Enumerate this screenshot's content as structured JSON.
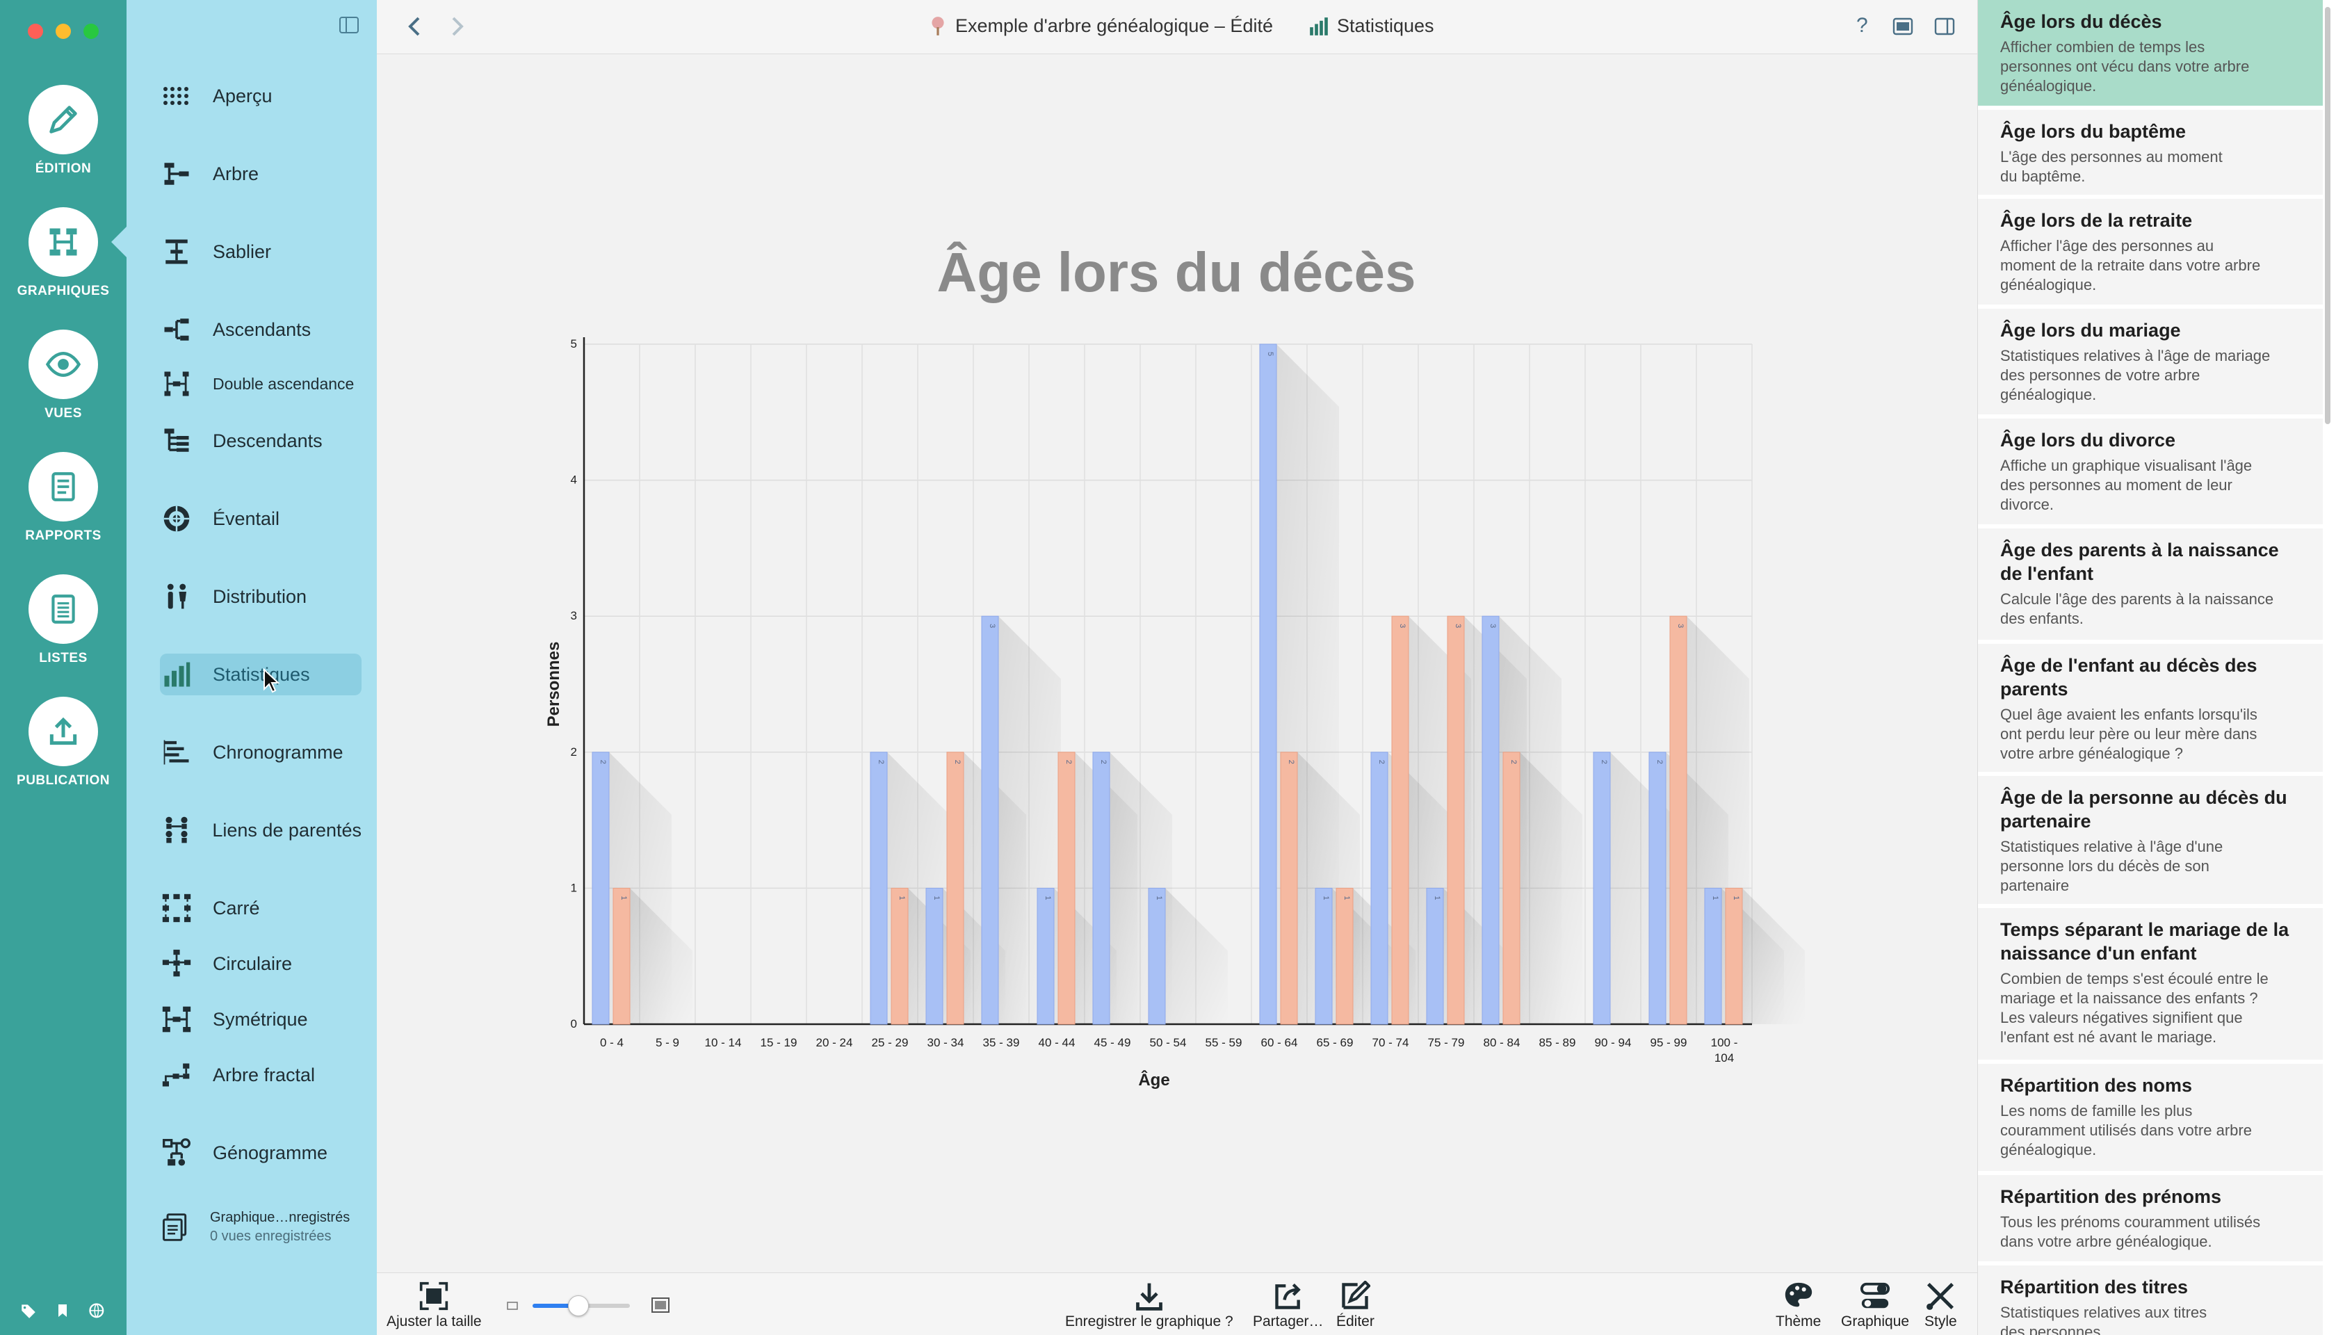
{
  "colors": {
    "rail_bg": "#3aa29a",
    "sidebar_bg": "#a8e0ef",
    "male_bar": "#a8c0f5",
    "female_bar": "#f5b9a1",
    "active_right": "#a9dcc9"
  },
  "modes": [
    {
      "label": "ÉDITION",
      "icon": "pencil-icon"
    },
    {
      "label": "GRAPHIQUES",
      "icon": "tree-chart-icon"
    },
    {
      "label": "VUES",
      "icon": "eye-icon"
    },
    {
      "label": "RAPPORTS",
      "icon": "report-icon"
    },
    {
      "label": "LISTES",
      "icon": "list-icon"
    },
    {
      "label": "PUBLICATION",
      "icon": "upload-icon"
    }
  ],
  "sidebar": {
    "items": [
      {
        "label": "Aperçu",
        "icon": "dots-grid-icon"
      },
      {
        "label": "Arbre",
        "icon": "tree-icon"
      },
      {
        "label": "Sablier",
        "icon": "hourglass-icon"
      },
      {
        "label": "Ascendants",
        "icon": "ancestors-icon"
      },
      {
        "label": "Double ascendance",
        "icon": "double-ancestry-icon"
      },
      {
        "label": "Descendants",
        "icon": "descendants-icon"
      },
      {
        "label": "Éventail",
        "icon": "fan-icon"
      },
      {
        "label": "Distribution",
        "icon": "distribution-icon"
      },
      {
        "label": "Statistiques",
        "icon": "bar-chart-icon"
      },
      {
        "label": "Chronogramme",
        "icon": "timeline-icon"
      },
      {
        "label": "Liens de parentés",
        "icon": "relationship-icon"
      },
      {
        "label": "Carré",
        "icon": "square-icon"
      },
      {
        "label": "Circulaire",
        "icon": "circular-icon"
      },
      {
        "label": "Symétrique",
        "icon": "symmetric-icon"
      },
      {
        "label": "Arbre fractal",
        "icon": "fractal-tree-icon"
      },
      {
        "label": "Génogramme",
        "icon": "genogram-icon"
      }
    ],
    "saved_title": "Graphique…nregistrés",
    "saved_subtitle": "0 vues enregistrées"
  },
  "toolbar": {
    "document_title": "Exemple d'arbre généalogique – Édité",
    "section_title": "Statistiques",
    "help": "?"
  },
  "bottombar": {
    "fit_label": "Ajuster la taille",
    "save_chart_label": "Enregistrer le graphique ?",
    "share_label": "Partager…",
    "edit_label": "Éditer",
    "theme_label": "Thème",
    "chart_label": "Graphique",
    "style_label": "Style",
    "zoom_fraction": 0.47
  },
  "chart_data": {
    "type": "bar",
    "title": "Âge lors du décès",
    "xlabel": "Âge",
    "ylabel": "Personnes",
    "ylim": [
      0,
      5
    ],
    "yticks": [
      "0",
      "1",
      "2",
      "3",
      "4",
      "5"
    ],
    "grid": true,
    "categories": [
      "0 - 4",
      "5 - 9",
      "10 - 14",
      "15 - 19",
      "20 - 24",
      "25 - 29",
      "30 - 34",
      "35 - 39",
      "40 - 44",
      "45 - 49",
      "50 - 54",
      "55 - 59",
      "60 - 64",
      "65 - 69",
      "70 - 74",
      "75 - 79",
      "80 - 84",
      "85 - 89",
      "90 - 94",
      "95 - 99",
      "100 - 104"
    ],
    "series": [
      {
        "values": [
          2,
          0,
          0,
          0,
          0,
          2,
          1,
          3,
          1,
          2,
          1,
          0,
          5,
          1,
          2,
          1,
          3,
          0,
          2,
          2,
          1
        ]
      },
      {
        "values": [
          1,
          0,
          0,
          0,
          0,
          1,
          2,
          0,
          2,
          0,
          0,
          0,
          2,
          1,
          3,
          3,
          2,
          0,
          0,
          3,
          1
        ]
      }
    ]
  },
  "rpanel": {
    "items": [
      {
        "title": "Âge lors du décès",
        "desc": [
          "Afficher combien de temps les",
          "personnes ont vécu dans votre arbre",
          "généalogique."
        ]
      },
      {
        "title": "Âge lors du baptême",
        "desc": [
          "L'âge des personnes au moment",
          "du baptême."
        ]
      },
      {
        "title": "Âge lors de la retraite",
        "desc": [
          "Afficher l'âge des personnes au",
          "moment de la retraite dans votre arbre",
          "généalogique."
        ]
      },
      {
        "title": "Âge lors du mariage",
        "desc": [
          "Statistiques relatives à l'âge de mariage",
          "des personnes de votre arbre",
          "généalogique."
        ]
      },
      {
        "title": "Âge lors du divorce",
        "desc": [
          "Affiche un graphique visualisant l'âge",
          "des personnes au moment de leur",
          "divorce."
        ]
      },
      {
        "title": "Âge des parents à la naissance de l'enfant",
        "desc": [
          "Calcule l'âge des parents à la naissance",
          "des enfants."
        ]
      },
      {
        "title": "Âge de l'enfant au décès des parents",
        "desc": [
          "Quel âge avaient les enfants lorsqu'ils",
          "ont perdu leur père ou leur mère dans",
          "votre arbre généalogique ?"
        ]
      },
      {
        "title": "Âge de la personne au décès du partenaire",
        "desc": [
          "Statistiques relative à l'âge d'une",
          "personne lors du décès de son",
          "partenaire"
        ]
      },
      {
        "title": "Temps séparant le mariage de la naissance d'un enfant",
        "desc": [
          "Combien de temps s'est écoulé entre le",
          "mariage et la naissance des enfants ?",
          "Les valeurs négatives signifient que",
          "l'enfant est né avant le mariage."
        ]
      },
      {
        "title": "Répartition des noms",
        "desc": [
          "Les noms de famille les plus",
          "couramment utilisés dans votre arbre",
          "généalogique."
        ]
      },
      {
        "title": "Répartition des prénoms",
        "desc": [
          "Tous les prénoms couramment utilisés",
          "dans votre arbre généalogique."
        ]
      },
      {
        "title": "Répartition des titres",
        "desc": [
          "Statistiques relatives aux titres",
          "des personnes."
        ]
      }
    ]
  }
}
